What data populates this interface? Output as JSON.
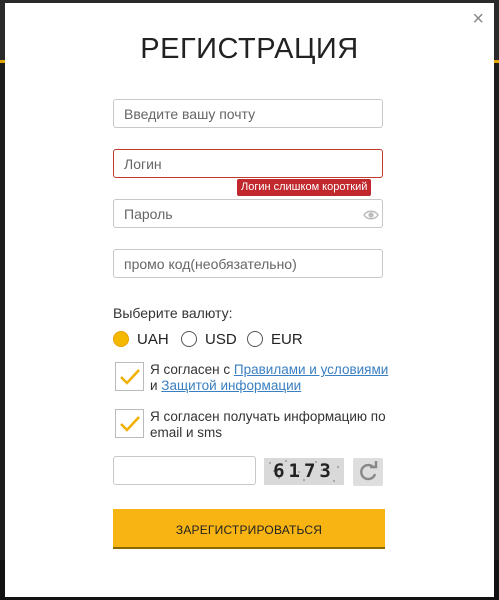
{
  "modal": {
    "title": "РЕГИСТРАЦИЯ",
    "close_icon": "×"
  },
  "form": {
    "email_placeholder": "Введите вашу почту",
    "login_placeholder": "Логин",
    "login_error": "Логин слишком короткий",
    "password_placeholder": "Пароль",
    "promo_placeholder": "промо код(необязательно)",
    "currency_label": "Выберите валюту:",
    "currencies": [
      {
        "label": "UAH",
        "selected": true
      },
      {
        "label": "USD",
        "selected": false
      },
      {
        "label": "EUR",
        "selected": false
      }
    ],
    "terms": {
      "prefix": "Я согласен с ",
      "rules_link": "Правилами и условиями",
      "middle": " и ",
      "privacy_link": "Защитой информации",
      "checked": true
    },
    "newsletter": {
      "text": "Я согласен получать информацию по email и sms",
      "checked": true
    },
    "captcha_code": "6173",
    "submit_label": "ЗАРЕГИСТРИРОВАТЬСЯ"
  },
  "colors": {
    "accent": "#f7b413",
    "error": "#c0282e",
    "link": "#3a7fc1"
  }
}
